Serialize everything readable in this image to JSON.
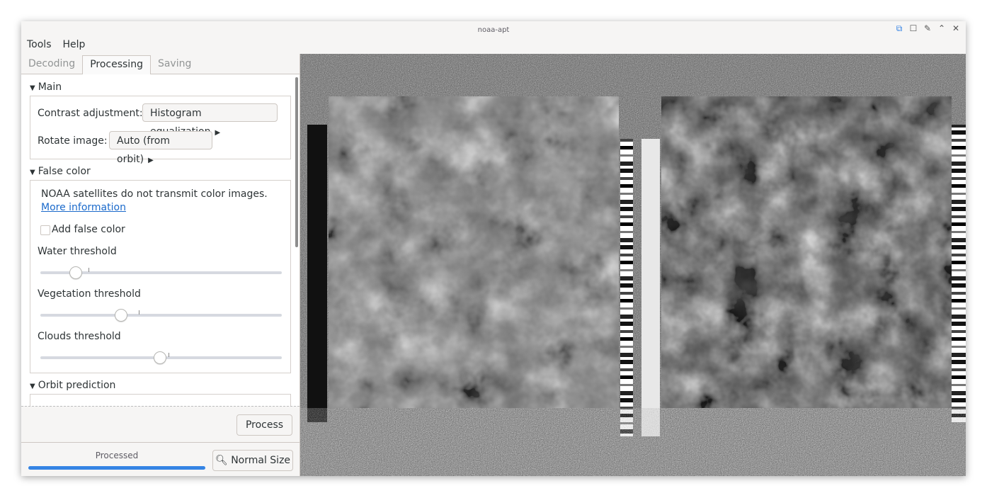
{
  "window": {
    "title": "noaa-apt"
  },
  "menubar": {
    "items": [
      "Tools",
      "Help"
    ]
  },
  "tabs": [
    {
      "label": "Decoding",
      "active": false
    },
    {
      "label": "Processing",
      "active": true
    },
    {
      "label": "Saving",
      "active": false
    }
  ],
  "main_section": {
    "header": "Main",
    "contrast_label": "Contrast adjustment:",
    "contrast_value": "Histogram equalization",
    "rotate_label": "Rotate image:",
    "rotate_value": "Auto (from orbit)"
  },
  "false_color": {
    "header": "False color",
    "info_text": "NOAA satellites do not transmit color images.",
    "more_info_link": "More information",
    "add_false_color_label": "Add false color",
    "add_false_color_checked": false,
    "water_label": "Water threshold",
    "water_value": 0.15,
    "vegetation_label": "Vegetation threshold",
    "vegetation_value": 0.33,
    "clouds_label": "Clouds threshold",
    "clouds_value": 0.5
  },
  "orbit_section": {
    "header": "Orbit prediction"
  },
  "actions": {
    "process_label": "Process"
  },
  "status": {
    "text": "Processed",
    "progress": 1.0,
    "normal_size_label": "Normal Size"
  }
}
